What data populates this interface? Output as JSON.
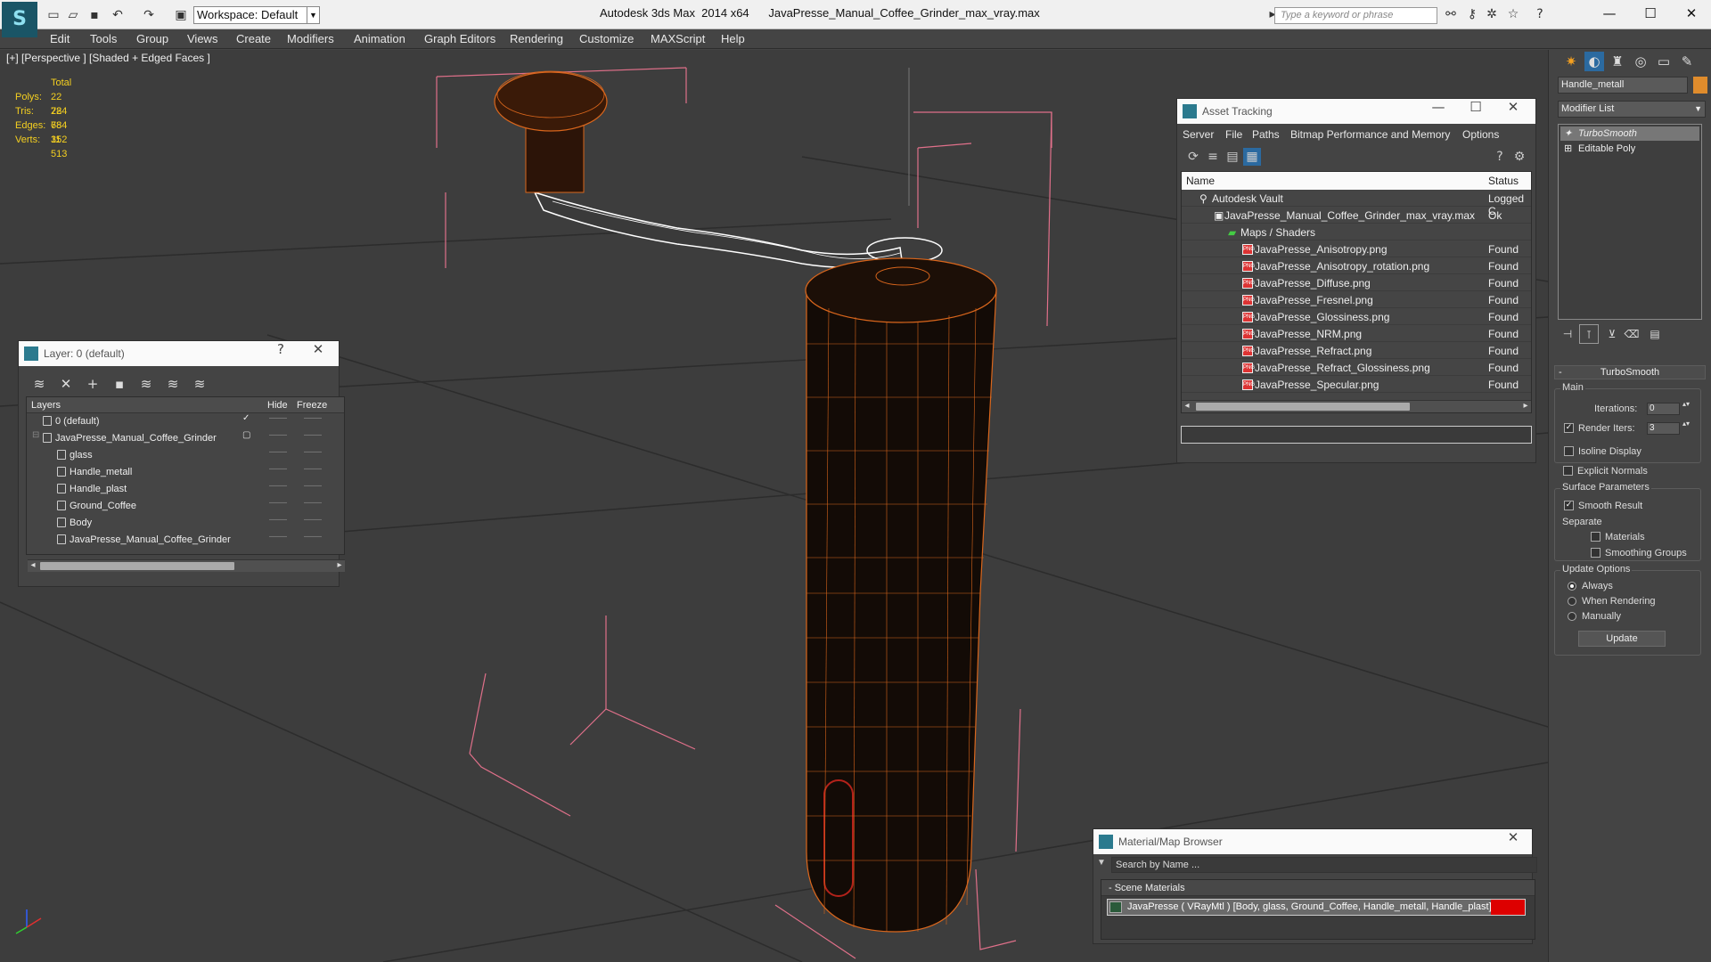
{
  "titlebar": {
    "app_name": "Autodesk 3ds Max  2014 x64",
    "file_name": "JavaPresse_Manual_Coffee_Grinder_max_vray.max",
    "workspace": "Workspace: Default",
    "keyword_placeholder": "Type a keyword or phrase"
  },
  "menu": [
    "Edit",
    "Tools",
    "Group",
    "Views",
    "Create",
    "Modifiers",
    "Animation",
    "Graph Editors",
    "Rendering",
    "Customize",
    "MAXScript",
    "Help"
  ],
  "viewport": {
    "label": "[+] [Perspective ] [Shaded + Edged Faces ]",
    "stats": {
      "header": "Total",
      "polys_label": "Polys:",
      "polys": "22 784",
      "tris_label": "Tris:",
      "tris": "22 784",
      "edges_label": "Edges:",
      "edges": "68 352",
      "verts_label": "Verts:",
      "verts": "11 513"
    }
  },
  "layer_panel": {
    "title": "Layer: 0 (default)",
    "columns": [
      "Layers",
      "Hide",
      "Freeze"
    ],
    "rows": [
      "0 (default)",
      "JavaPresse_Manual_Coffee_Grinder",
      "glass",
      "Handle_metall",
      "Handle_plast",
      "Ground_Coffee",
      "Body",
      "JavaPresse_Manual_Coffee_Grinder"
    ]
  },
  "asset_tracking": {
    "title": "Asset Tracking",
    "menu": [
      "Server",
      "File",
      "Paths",
      "Bitmap Performance and Memory",
      "Options"
    ],
    "columns": [
      "Name",
      "Status"
    ],
    "rows": [
      {
        "name": "Autodesk Vault",
        "status": "Logged C"
      },
      {
        "name": "JavaPresse_Manual_Coffee_Grinder_max_vray.max",
        "status": "Ok"
      },
      {
        "name": "Maps / Shaders",
        "status": ""
      },
      {
        "name": "JavaPresse_Anisotropy.png",
        "status": "Found"
      },
      {
        "name": "JavaPresse_Anisotropy_rotation.png",
        "status": "Found"
      },
      {
        "name": "JavaPresse_Diffuse.png",
        "status": "Found"
      },
      {
        "name": "JavaPresse_Fresnel.png",
        "status": "Found"
      },
      {
        "name": "JavaPresse_Glossiness.png",
        "status": "Found"
      },
      {
        "name": "JavaPresse_NRM.png",
        "status": "Found"
      },
      {
        "name": "JavaPresse_Refract.png",
        "status": "Found"
      },
      {
        "name": "JavaPresse_Refract_Glossiness.png",
        "status": "Found"
      },
      {
        "name": "JavaPresse_Specular.png",
        "status": "Found"
      }
    ]
  },
  "material_browser": {
    "title": "Material/Map Browser",
    "search_placeholder": "Search by Name ...",
    "section": "- Scene Materials",
    "item": "JavaPresse  ( VRayMtl ) [Body, glass, Ground_Coffee, Handle_metall, Handle_plast]"
  },
  "command_panel": {
    "object_name": "Handle_metall",
    "modifier_list": "Modifier List",
    "stack": [
      "TurboSmooth",
      "Editable Poly"
    ],
    "rollout": "TurboSmooth",
    "main": "Main",
    "iterations_label": "Iterations:",
    "iterations": "0",
    "render_iters_label": "Render Iters:",
    "render_iters": "3",
    "isoline": "Isoline Display",
    "explicit": "Explicit Normals",
    "surface": "Surface Parameters",
    "smooth": "Smooth Result",
    "separate": "Separate",
    "materials": "Materials",
    "smoothing_groups": "Smoothing Groups",
    "update_options": "Update Options",
    "always": "Always",
    "when_rendering": "When Rendering",
    "manually": "Manually",
    "update_btn": "Update"
  },
  "colors": {
    "wire": "#d9661c",
    "bbox": "#e0708a",
    "accent": "#2b7a8e",
    "stats": "#f5d020"
  }
}
